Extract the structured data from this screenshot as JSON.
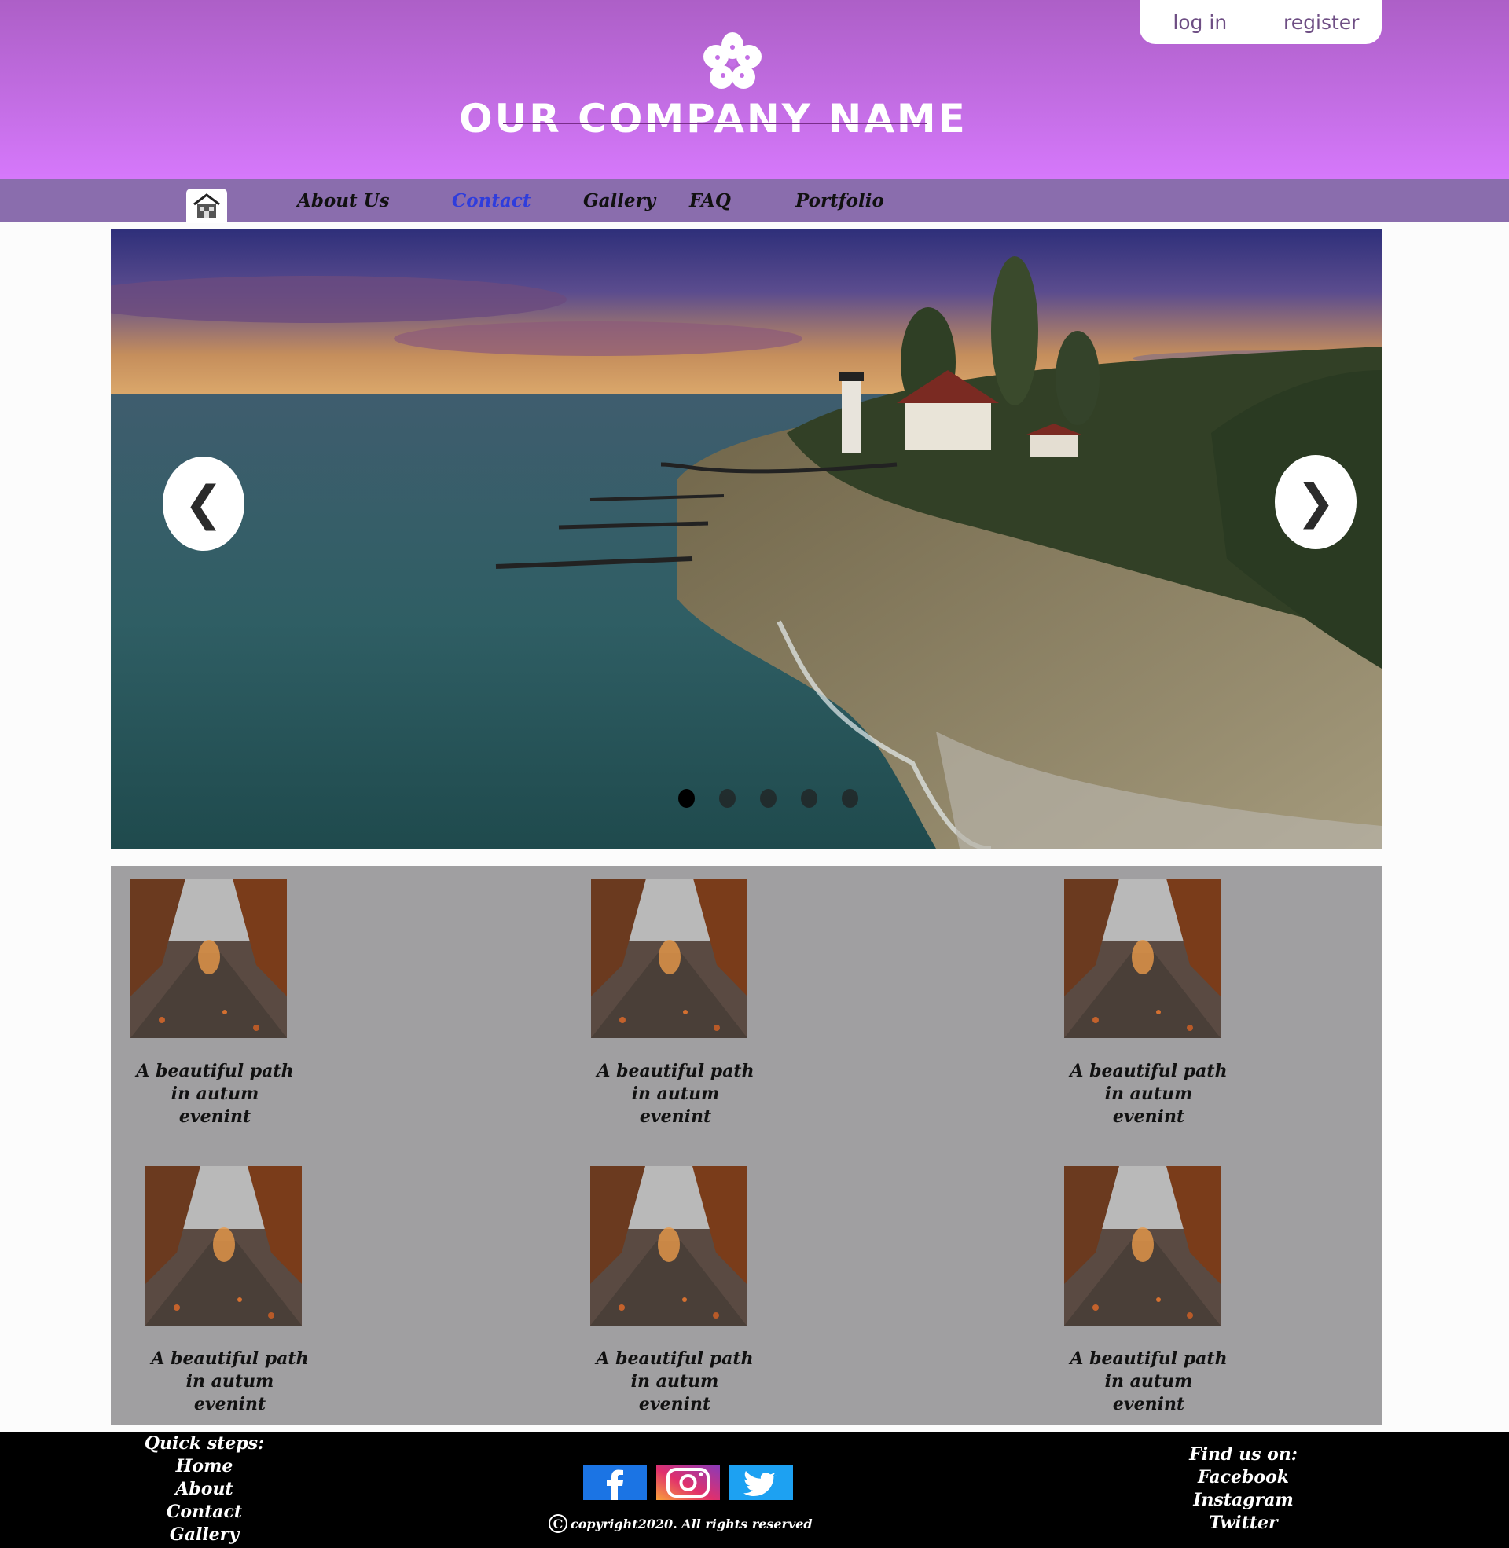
{
  "header": {
    "company_name": "OUR COMPANY NAME",
    "auth": {
      "login": "log in",
      "register": "register"
    },
    "logo_icon": "flower-icon",
    "colors": {
      "gradient_top": "#ad5fc7",
      "gradient_bottom": "#d678fb"
    }
  },
  "nav": {
    "home_icon": "house-icon",
    "items": [
      {
        "label": "About Us",
        "active": false
      },
      {
        "label": "Contact",
        "active": true
      },
      {
        "label": "Gallery",
        "active": false
      },
      {
        "label": "FAQ",
        "active": false
      },
      {
        "label": "Portfolio",
        "active": false
      }
    ],
    "colors": {
      "background": "#8a6dad",
      "active": "#2f3ddc"
    }
  },
  "slider": {
    "prev_glyph": "❮",
    "next_glyph": "❯",
    "slide_count": 5,
    "active_slide": 1
  },
  "gallery": {
    "cards": [
      {
        "caption_lines": [
          "A beautiful path",
          "in autum",
          "evenint"
        ]
      },
      {
        "caption_lines": [
          "A beautiful path",
          "in autum",
          "evenint"
        ]
      },
      {
        "caption_lines": [
          "A beautiful path",
          "in autum",
          "evenint"
        ]
      },
      {
        "caption_lines": [
          "A beautiful path",
          "in autum",
          "evenint"
        ]
      },
      {
        "caption_lines": [
          "A beautiful path",
          "in autum",
          "evenint"
        ]
      },
      {
        "caption_lines": [
          "A beautiful path",
          "in autum",
          "evenint"
        ]
      }
    ]
  },
  "footer": {
    "quick_steps": {
      "title": "Quick steps:",
      "items": [
        "Home",
        "About",
        "Contact",
        "Gallery"
      ]
    },
    "find_us": {
      "title": "Find us on:",
      "items": [
        "Facebook",
        "Instagram",
        "Twitter"
      ]
    },
    "social_icons": [
      "facebook-icon",
      "instagram-icon",
      "twitter-icon"
    ],
    "copyright": "copyright2020. All rights reserved"
  }
}
